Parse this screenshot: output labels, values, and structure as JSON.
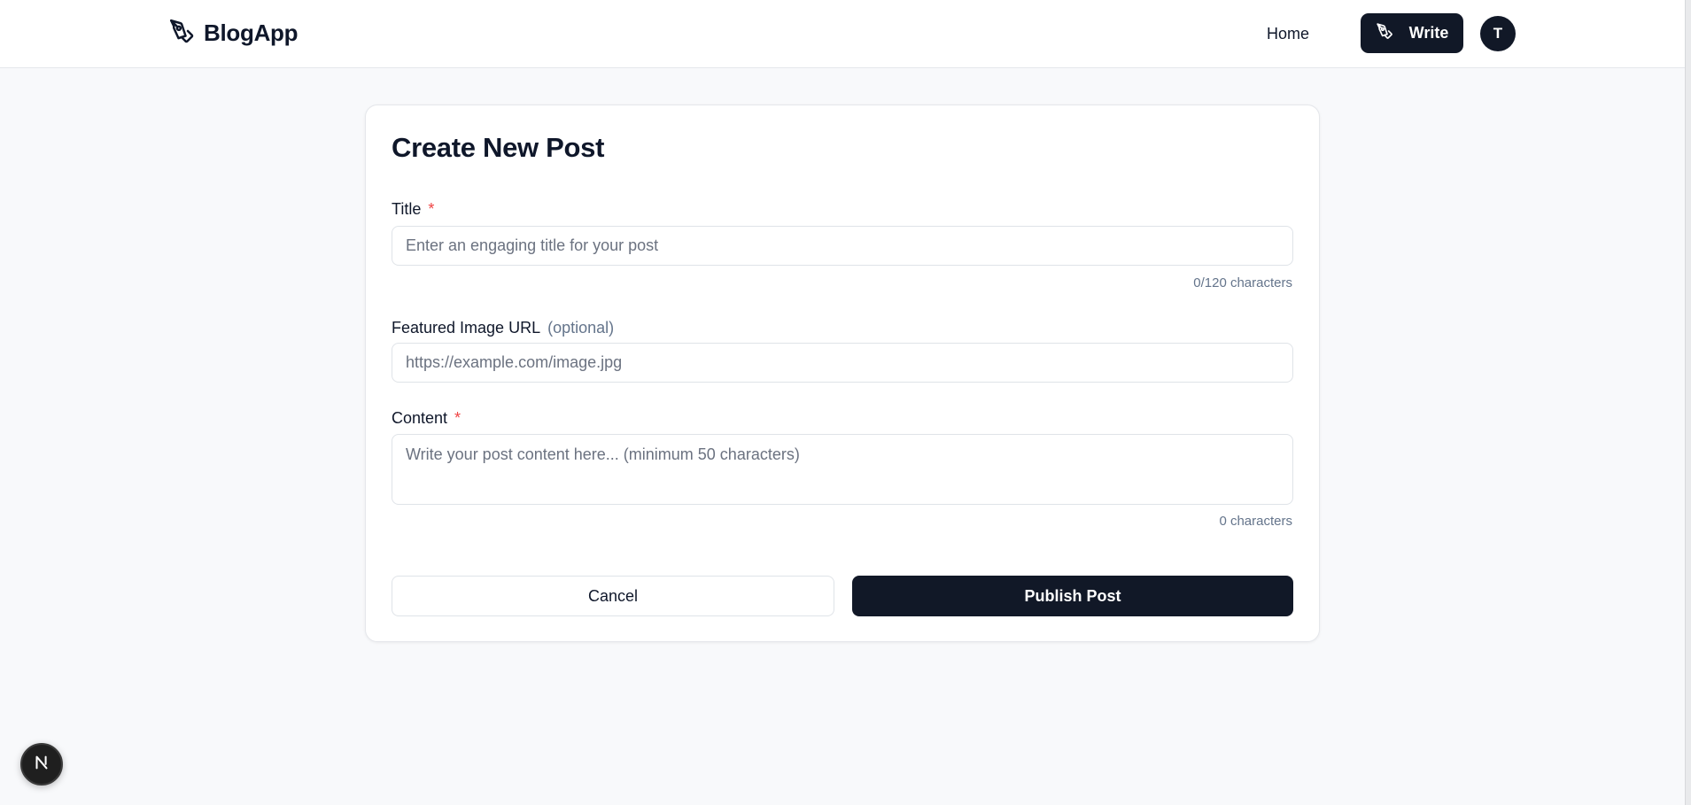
{
  "header": {
    "brand_name": "BlogApp",
    "brand_icon": "pen-tool-icon",
    "nav_home": "Home",
    "write_label": "Write",
    "write_icon": "pen-tool-icon",
    "avatar_initial": "T"
  },
  "form": {
    "title": "Create New Post",
    "title_field": {
      "label": "Title",
      "required_mark": "*",
      "placeholder": "Enter an engaging title for your post",
      "value": "",
      "counter": "0/120 characters"
    },
    "image_field": {
      "label": "Featured Image URL",
      "optional_note": "(optional)",
      "placeholder": "https://example.com/image.jpg",
      "value": ""
    },
    "content_field": {
      "label": "Content",
      "required_mark": "*",
      "placeholder": "Write your post content here... (minimum 50 characters)",
      "value": "",
      "counter": "0 characters"
    },
    "cancel_label": "Cancel",
    "publish_label": "Publish Post"
  },
  "dev_indicator": {
    "icon": "nextjs-logo-icon",
    "letter": "N"
  },
  "colors": {
    "primary": "#111827",
    "required": "#ef4444",
    "muted": "#64748b",
    "background": "#f8f9fb"
  }
}
